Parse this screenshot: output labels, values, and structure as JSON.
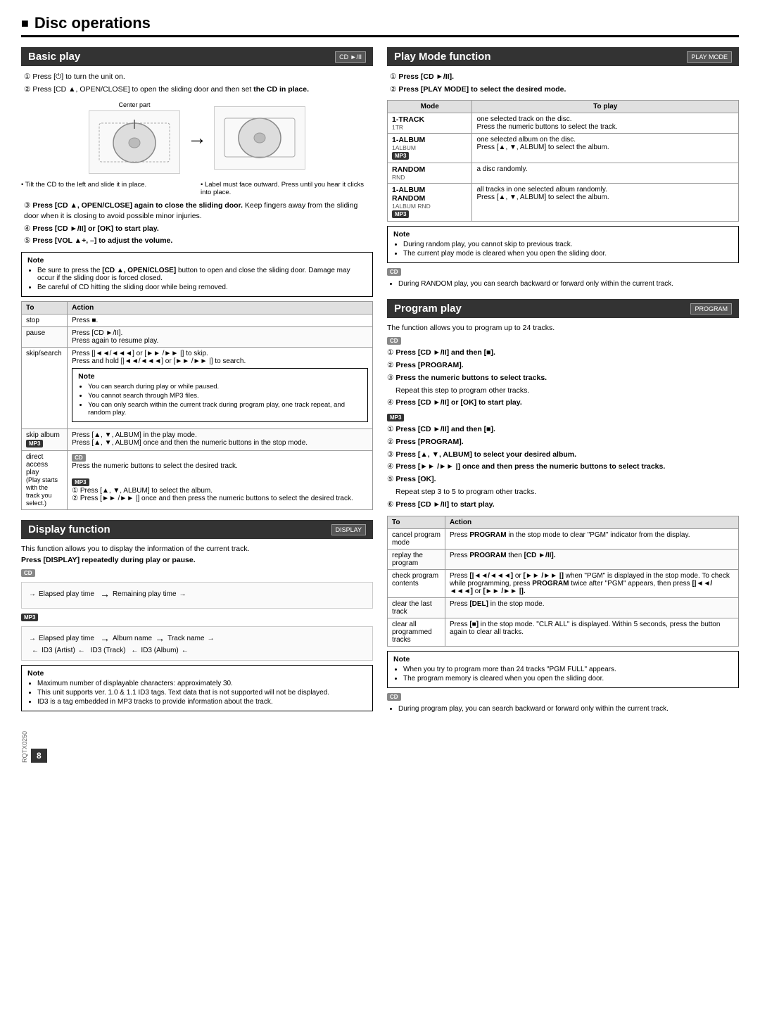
{
  "page": {
    "title": "Disc operations",
    "page_number": "8",
    "doc_code": "RQTX0250"
  },
  "basic_play": {
    "header": "Basic play",
    "badge": "CD ►/II",
    "steps": [
      "① Press [⏻] to turn the unit on.",
      "② Press [CD ▲, OPEN/CLOSE] to open the sliding door and then set the CD in place.",
      "③ Press [CD ▲, OPEN/CLOSE] again to close the sliding door. Keep fingers away from the sliding door when it is closing to avoid possible minor injuries.",
      "④ Press [CD ►/II] or [OK] to start play.",
      "⑤ Press [VOL ▲+, –] to adjust the volume."
    ],
    "diagram_label": "Center part",
    "bullet1": "Tilt the CD to the left and slide it in place.",
    "bullet2": "Label must face outward. Press until you hear it clicks into place.",
    "note_title": "Note",
    "notes": [
      "Be sure to press the [CD ▲, OPEN/CLOSE] button to open and close the sliding door. Damage may occur if the sliding door is forced closed.",
      "Be careful of CD hitting the sliding door while being removed."
    ],
    "table_headers": [
      "To",
      "Action"
    ],
    "table_rows": [
      {
        "to": "stop",
        "action": "Press ■.",
        "badge": null
      },
      {
        "to": "pause",
        "action": "Press [CD ►/II]. Press again to resume play.",
        "badge": null
      },
      {
        "to": "skip/search",
        "action": "Press [|◄◄/◄◄◄] or [►►►/►► |] to skip. Press and hold [|◄◄/◄◄◄] or [►►►/►► |] to search.",
        "note": "You can search during play or while paused. You cannot search through MP3 files. You can only search within the current track during program play, one track repeat, and random play.",
        "badge": null
      },
      {
        "to": "skip album",
        "action_cd": "Press [▲, ▼, ALBUM] in the play mode. Press [▲, ▼, ALBUM] once and then the numeric buttons in the stop mode.",
        "badge": "MP3"
      },
      {
        "to": "direct access play",
        "action_cd": "Press the numeric buttons to select the desired track.",
        "action_mp3_1": "① Press [▲, ▼, ALBUM] to select the album.",
        "action_mp3_2": "② Press [►► /►► |] once and then press the numeric buttons to select the desired track.",
        "badge_cd": "CD",
        "badge_mp3": "MP3",
        "play_note": "(Play starts with the track you select.)"
      }
    ]
  },
  "display_function": {
    "header": "Display function",
    "badge": "DISPLAY",
    "intro": "This function allows you to display the information of the current track.",
    "press_text": "Press [DISPLAY] repeatedly during play or pause.",
    "cd_badge": "CD",
    "cd_timeline": [
      "Elapsed play time",
      "Remaining play time"
    ],
    "mp3_badge": "MP3",
    "mp3_timeline": [
      "Elapsed play time",
      "Album name",
      "Track name"
    ],
    "mp3_id3": [
      "ID3 (Artist)",
      "ID3 (Track)",
      "ID3 (Album)"
    ],
    "note_title": "Note",
    "notes": [
      "Maximum number of displayable characters: approximately 30.",
      "This unit supports ver. 1.0 & 1.1 ID3 tags. Text data that is not supported will not be displayed.",
      "ID3 is a tag embedded in MP3 tracks to provide information about the track."
    ]
  },
  "play_mode": {
    "header": "Play Mode function",
    "badge": "PLAY MODE",
    "steps": [
      "① Press [CD ►/II].",
      "② Press [PLAY MODE] to select the desired mode."
    ],
    "table_headers": [
      "Mode",
      "To play"
    ],
    "modes": [
      {
        "name": "1-TRACK",
        "code": "1TR",
        "description": "one selected track on the disc.",
        "detail": "Press the numeric buttons to select the track.",
        "badge": null
      },
      {
        "name": "1-ALBUM",
        "code": "1ALBUM",
        "description": "one selected album on the disc.",
        "detail": "Press [▲, ▼, ALBUM] to select the album.",
        "badge": "MP3"
      },
      {
        "name": "RANDOM",
        "code": "RND",
        "description": "a disc randomly.",
        "detail": null,
        "badge": null
      },
      {
        "name": "1-ALBUM RANDOM",
        "code": "1ALBUM RND",
        "description": "all tracks in one selected album randomly.",
        "detail": "Press [▲, ▼, ALBUM] to select the album.",
        "badge": "MP3"
      }
    ],
    "note_title": "Note",
    "notes": [
      "During random play, you cannot skip to previous track.",
      "The current play mode is cleared when you open the sliding door."
    ],
    "cd_note": "During RANDOM play, you can search backward or forward only within the current track."
  },
  "program_play": {
    "header": "Program play",
    "badge": "PROGRAM",
    "intro": "The function allows you to program up to 24 tracks.",
    "cd_badge": "CD",
    "cd_steps": [
      "① Press [CD ►/II] and then [■].",
      "② Press [PROGRAM].",
      "③ Press the numeric buttons to select tracks.",
      "Repeat this step to program other tracks.",
      "④ Press [CD ►/II] or [OK] to start play."
    ],
    "mp3_badge": "MP3",
    "mp3_steps": [
      "① Press [CD ►/II] and then [■].",
      "② Press [PROGRAM].",
      "③ Press [▲, ▼, ALBUM] to select your desired album.",
      "④ Press [►► /►► |] once and then press the numeric buttons to select tracks.",
      "⑤ Press [OK].",
      "Repeat step 3 to 5 to program other tracks.",
      "⑥ Press [CD ►/II] to start play."
    ],
    "table_headers": [
      "To",
      "Action"
    ],
    "table_rows": [
      {
        "to": "cancel program mode",
        "action": "Press PROGRAM in the stop mode to clear \"PGM\" indicator from the display."
      },
      {
        "to": "replay the program",
        "action": "Press PROGRAM then [CD ►/II]."
      },
      {
        "to": "check program contents",
        "action": "Press [|◄◄/◄◄◄] or [►► /►► |] when \"PGM\" is displayed in the stop mode. To check while programming, press PROGRAM twice after \"PGM\" appears, then press [|◄◄/◄◄◄] or [►► /►► |]."
      },
      {
        "to": "clear the last track",
        "action": "Press [DEL] in the stop mode."
      },
      {
        "to": "clear all programmed tracks",
        "action": "Press [■] in the stop mode. \"CLR ALL\" is displayed. Within 5 seconds, press the button again to clear all tracks."
      }
    ],
    "note_title": "Note",
    "notes": [
      "When you try to program more than 24 tracks \"PGM FULL\" appears.",
      "The program memory is cleared when you open the sliding door."
    ],
    "cd_note": "During program play, you can search backward or forward only within the current track."
  }
}
